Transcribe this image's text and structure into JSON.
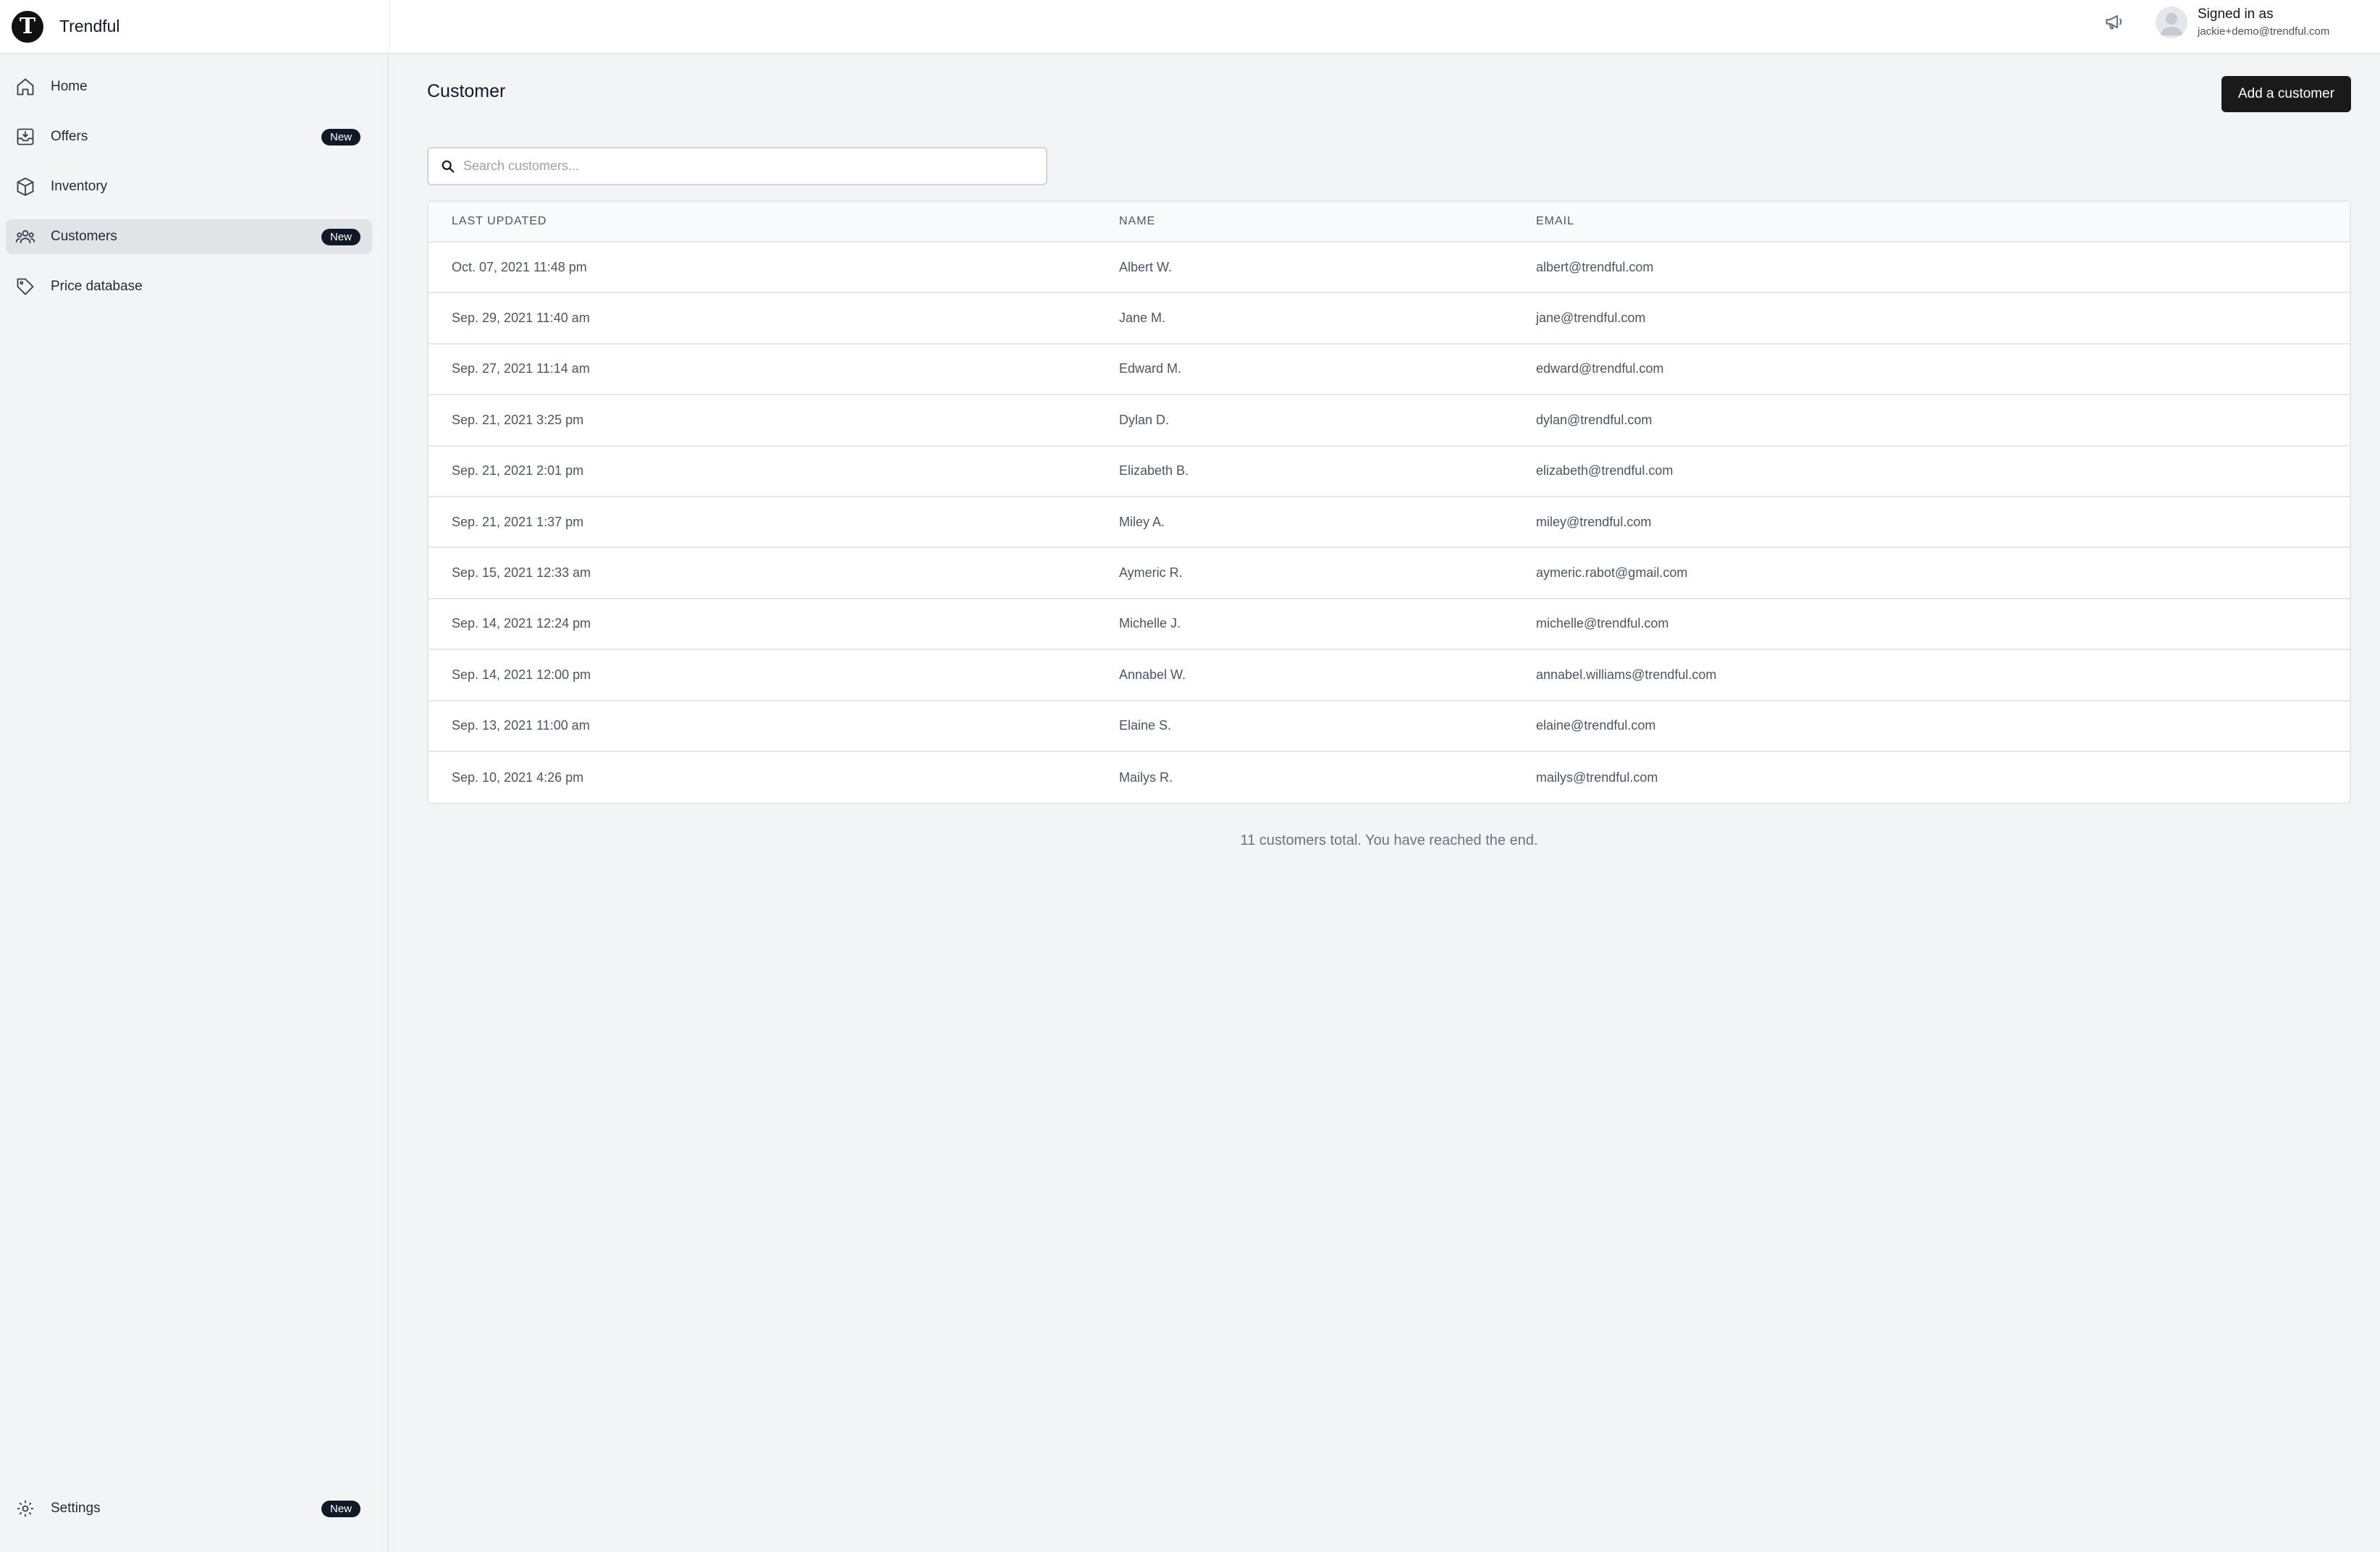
{
  "brand": {
    "logo_letter": "T",
    "name": "Trendful"
  },
  "sidebar": {
    "items": [
      {
        "label": "Home",
        "icon": "home-icon",
        "badge": ""
      },
      {
        "label": "Offers",
        "icon": "inbox-download-icon",
        "badge": "New"
      },
      {
        "label": "Inventory",
        "icon": "box-icon",
        "badge": ""
      },
      {
        "label": "Customers",
        "icon": "users-icon",
        "badge": "New",
        "active": true
      },
      {
        "label": "Price database",
        "icon": "tag-icon",
        "badge": ""
      }
    ],
    "settings": {
      "label": "Settings",
      "icon": "gear-icon",
      "badge": "New"
    }
  },
  "header": {
    "announce_icon": "megaphone-icon",
    "signed_in_label": "Signed in as",
    "user_email": "jackie+demo@trendful.com"
  },
  "main": {
    "title": "Customer",
    "add_button_label": "Add a customer",
    "search_placeholder": "Search customers...",
    "columns": [
      "LAST UPDATED",
      "NAME",
      "EMAIL"
    ],
    "rows": [
      {
        "updated": "Oct. 07, 2021 11:48 pm",
        "name": "Albert W.",
        "email": "albert@trendful.com"
      },
      {
        "updated": "Sep. 29, 2021 11:40 am",
        "name": "Jane M.",
        "email": "jane@trendful.com"
      },
      {
        "updated": "Sep. 27, 2021 11:14 am",
        "name": "Edward M.",
        "email": "edward@trendful.com"
      },
      {
        "updated": "Sep. 21, 2021 3:25 pm",
        "name": "Dylan D.",
        "email": "dylan@trendful.com"
      },
      {
        "updated": "Sep. 21, 2021 2:01 pm",
        "name": "Elizabeth B.",
        "email": "elizabeth@trendful.com"
      },
      {
        "updated": "Sep. 21, 2021 1:37 pm",
        "name": "Miley A.",
        "email": "miley@trendful.com"
      },
      {
        "updated": "Sep. 15, 2021 12:33 am",
        "name": "Aymeric R.",
        "email": "aymeric.rabot@gmail.com"
      },
      {
        "updated": "Sep. 14, 2021 12:24 pm",
        "name": "Michelle J.",
        "email": "michelle@trendful.com"
      },
      {
        "updated": "Sep. 14, 2021 12:00 pm",
        "name": "Annabel W.",
        "email": "annabel.williams@trendful.com"
      },
      {
        "updated": "Sep. 13, 2021 11:00 am",
        "name": "Elaine S.",
        "email": "elaine@trendful.com"
      },
      {
        "updated": "Sep. 10, 2021 4:26 pm",
        "name": "Mailys R.",
        "email": "mailys@trendful.com"
      }
    ],
    "footer_note": "11 customers total. You have reached the end."
  },
  "colors": {
    "accent": "#111827",
    "background": "#f3f4f6",
    "border": "#e5e7eb",
    "active_nav": "#e2e3e6"
  }
}
